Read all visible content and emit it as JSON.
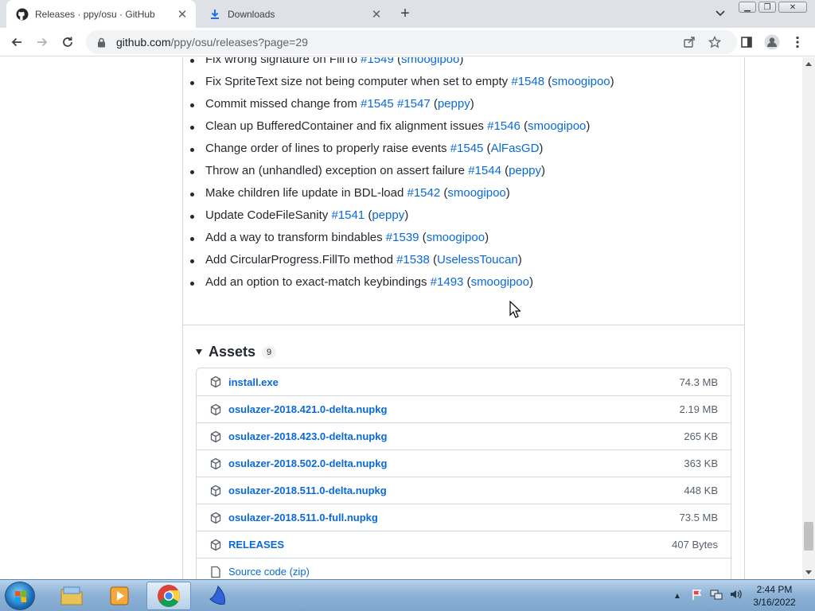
{
  "browser": {
    "tabs": [
      {
        "title": "Releases · ppy/osu · GitHub",
        "active": true,
        "icon": "github-icon"
      },
      {
        "title": "Downloads",
        "active": false,
        "icon": "download-icon"
      }
    ],
    "url_host": "github.com",
    "url_path": "/ppy/osu/releases?page=29"
  },
  "notes": [
    {
      "text": "Fix wrong signature on FillTo ",
      "prs": [
        "#1549"
      ],
      "author": "smoogipoo"
    },
    {
      "text": "Fix SpriteText size not being computer when set to empty ",
      "prs": [
        "#1548"
      ],
      "author": "smoogipoo"
    },
    {
      "text": "Commit missed change from ",
      "prs": [
        "#1545",
        "#1547"
      ],
      "author": "peppy"
    },
    {
      "text": "Clean up BufferedContainer and fix alignment issues ",
      "prs": [
        "#1546"
      ],
      "author": "smoogipoo"
    },
    {
      "text": "Change order of lines to properly raise events ",
      "prs": [
        "#1545"
      ],
      "author": "AlFasGD"
    },
    {
      "text": "Throw an (unhandled) exception on assert failure ",
      "prs": [
        "#1544"
      ],
      "author": "peppy"
    },
    {
      "text": "Make children life update in BDL-load ",
      "prs": [
        "#1542"
      ],
      "author": "smoogipoo"
    },
    {
      "text": "Update CodeFileSanity ",
      "prs": [
        "#1541"
      ],
      "author": "peppy"
    },
    {
      "text": "Add a way to transform bindables ",
      "prs": [
        "#1539"
      ],
      "author": "smoogipoo"
    },
    {
      "text": "Add CircularProgress.FillTo method ",
      "prs": [
        "#1538"
      ],
      "author": "UselessToucan"
    },
    {
      "text": "Add an option to exact-match keybindings ",
      "prs": [
        "#1493"
      ],
      "author": "smoogipoo"
    }
  ],
  "assets": {
    "label": "Assets",
    "count": "9",
    "items": [
      {
        "name": "install.exe",
        "size": "74.3 MB"
      },
      {
        "name": "osulazer-2018.421.0-delta.nupkg",
        "size": "2.19 MB"
      },
      {
        "name": "osulazer-2018.423.0-delta.nupkg",
        "size": "265 KB"
      },
      {
        "name": "osulazer-2018.502.0-delta.nupkg",
        "size": "363 KB"
      },
      {
        "name": "osulazer-2018.511.0-delta.nupkg",
        "size": "448 KB"
      },
      {
        "name": "osulazer-2018.511.0-full.nupkg",
        "size": "73.5 MB"
      },
      {
        "name": "RELEASES",
        "size": "407 Bytes"
      },
      {
        "name": "Source code (zip)",
        "size": ""
      }
    ]
  },
  "taskbar": {
    "time": "2:44 PM",
    "date": "3/16/2022"
  },
  "colors": {
    "link": "#0969da",
    "text": "#24292f",
    "border": "#d0d7de"
  }
}
